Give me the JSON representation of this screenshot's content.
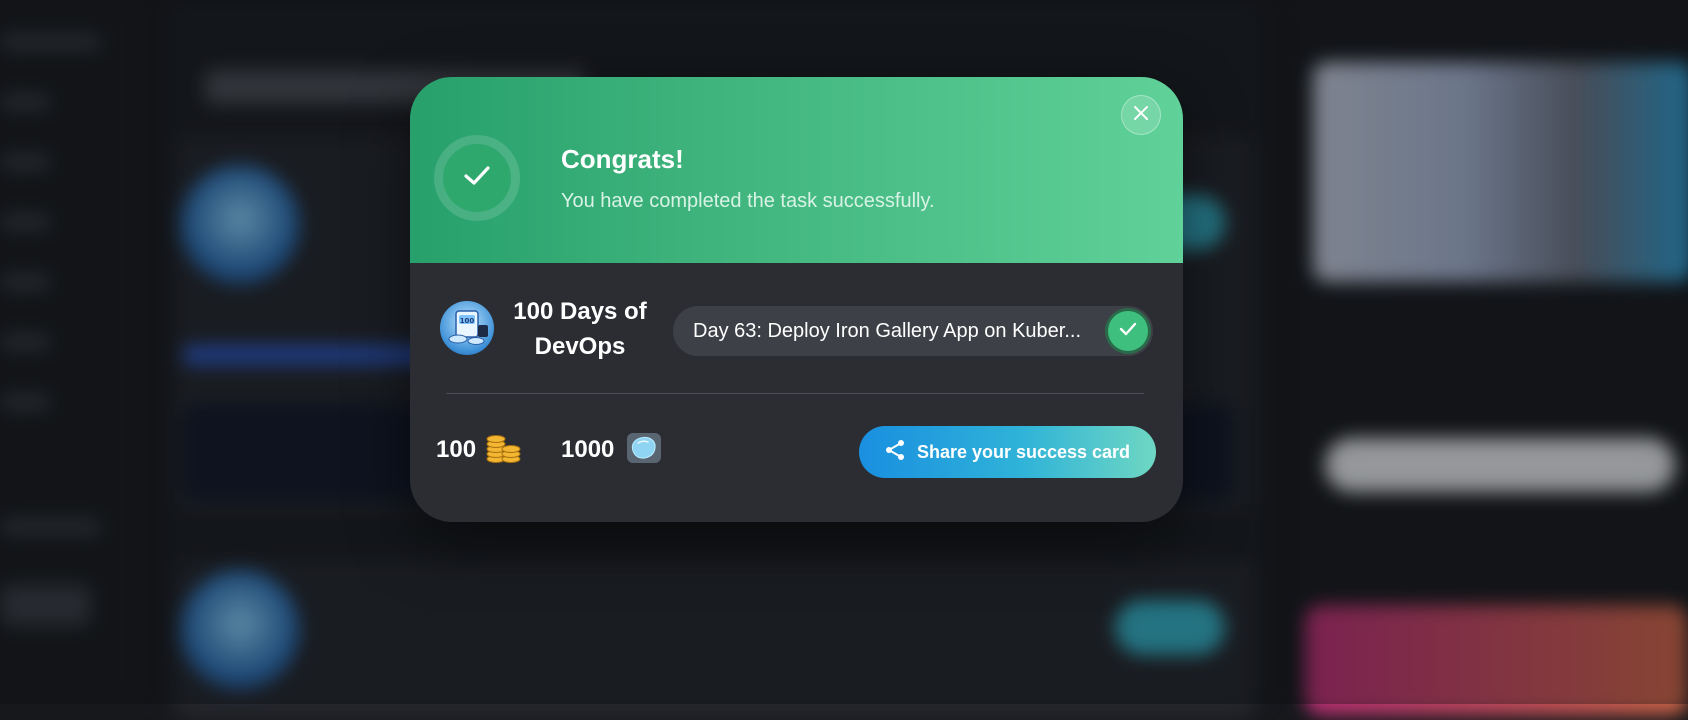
{
  "modal": {
    "title": "Congrats!",
    "subtitle": "You have completed the task successfully.",
    "course_name": "100 Days of DevOps",
    "task_title": "Day 63: Deploy Iron Gallery App on Kuber...",
    "coins_value": "100",
    "gems_value": "1000",
    "share_label": "Share your success card",
    "icons": {
      "close": "close-icon",
      "success": "check-icon",
      "task_done": "check-icon",
      "coins": "coins-icon",
      "gems": "gem-icon",
      "share": "share-icon"
    },
    "colors": {
      "header_start": "#27a06c",
      "header_end": "#5fd199",
      "body": "#2b2d33",
      "share_start": "#1a8fe0",
      "share_end": "#6fd7c3"
    }
  }
}
